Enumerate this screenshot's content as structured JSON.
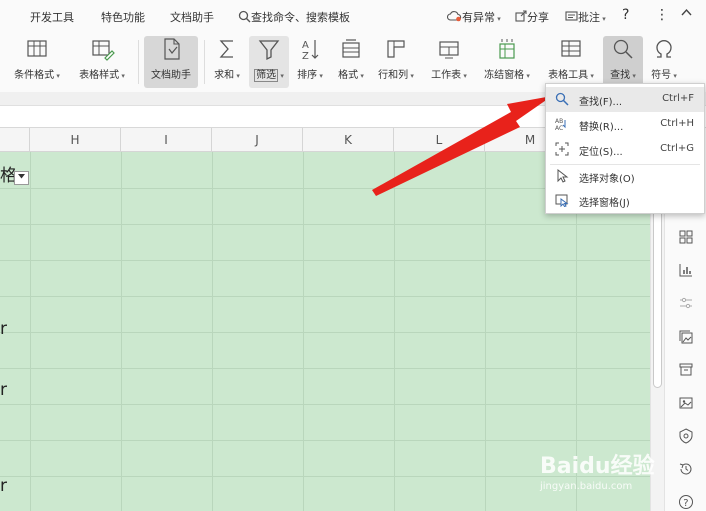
{
  "menubar": {
    "tabs": [
      "开发工具",
      "特色功能",
      "文档助手"
    ],
    "search_text": "查找命令、搜索模板",
    "status": "有异常",
    "share": "分享",
    "comment": "批注",
    "help": "?",
    "more": "⋮",
    "collapse": "^"
  },
  "ribbon": {
    "buttons": [
      {
        "label": "条件格式",
        "icon": "conditional-format-icon"
      },
      {
        "label": "表格样式",
        "icon": "table-style-icon"
      },
      {
        "label": "文档助手",
        "icon": "doc-assistant-icon"
      },
      {
        "label": "求和",
        "icon": "sum-icon"
      },
      {
        "label": "筛选",
        "icon": "filter-icon"
      },
      {
        "label": "排序",
        "icon": "sort-icon"
      },
      {
        "label": "格式",
        "icon": "format-icon"
      },
      {
        "label": "行和列",
        "icon": "rows-cols-icon"
      },
      {
        "label": "工作表",
        "icon": "worksheet-icon"
      },
      {
        "label": "冻结窗格",
        "icon": "freeze-panes-icon"
      },
      {
        "label": "表格工具",
        "icon": "table-tools-icon"
      },
      {
        "label": "查找",
        "icon": "find-icon"
      },
      {
        "label": "符号",
        "icon": "symbol-icon"
      }
    ]
  },
  "columns": [
    "H",
    "I",
    "J",
    "K",
    "L",
    "M"
  ],
  "cells": {
    "c1": "格",
    "c2": "r",
    "c3": "r",
    "c4": "r"
  },
  "dropdown": {
    "items": [
      {
        "label": "查找(F)...",
        "shortcut": "Ctrl+F",
        "icon": "search-icon"
      },
      {
        "label": "替换(R)...",
        "shortcut": "Ctrl+H",
        "icon": "replace-icon"
      },
      {
        "label": "定位(S)...",
        "shortcut": "Ctrl+G",
        "icon": "locate-icon"
      },
      {
        "label": "选择对象(O)",
        "shortcut": "",
        "icon": "select-object-icon"
      },
      {
        "label": "选择窗格(J)",
        "shortcut": "",
        "icon": "selection-pane-icon"
      }
    ]
  },
  "watermark": {
    "logo": "Baidu经验",
    "sub": "jingyan.baidu.com"
  },
  "colors": {
    "grid_green": "#cce8cf",
    "arrow_red": "#e8221b"
  }
}
